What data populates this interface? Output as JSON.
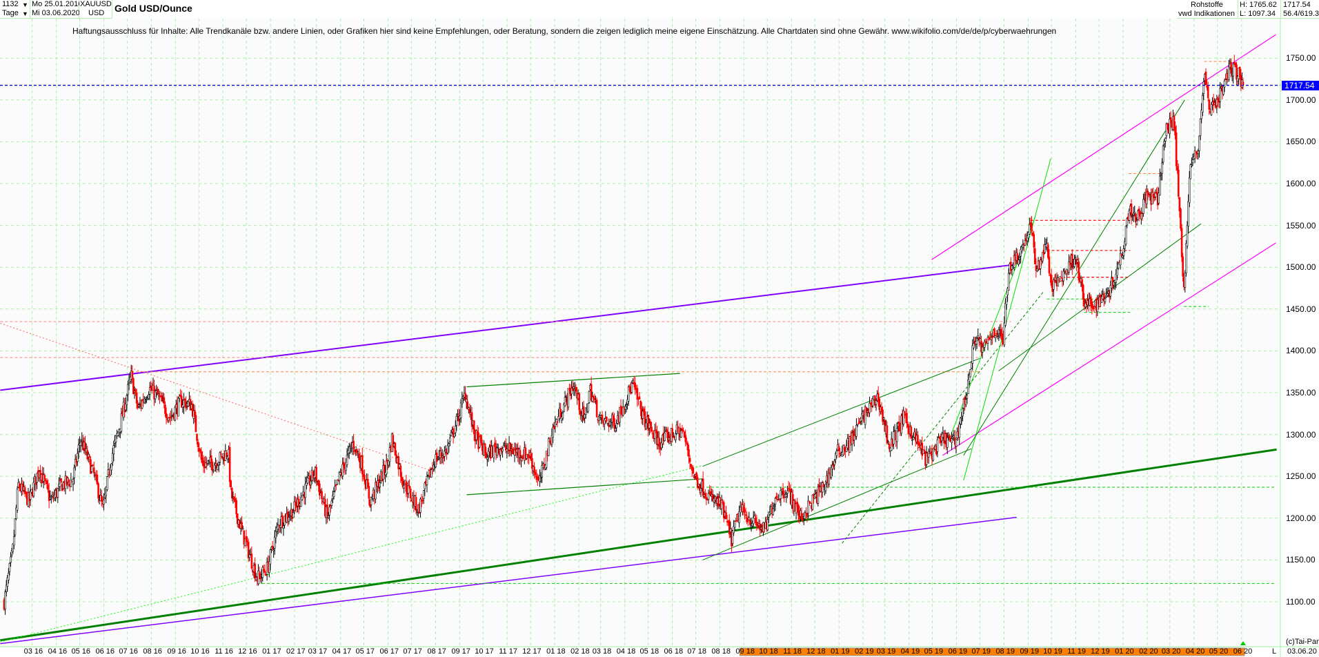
{
  "header": {
    "bars": "1132",
    "period": "Tage",
    "from_date": "Mo 25.01.2016",
    "to_date": "Mi 03.06.2020",
    "symbol": "XAUUSD",
    "currency": "USD",
    "title": "Gold USD/Ounce",
    "category": "Rohstoffe",
    "source": "vwd Indikationen",
    "high": "H: 1765.62",
    "low": "L: 1097.34",
    "last": "1717.54",
    "extra": "56.4/619.3",
    "disclaimer": "Haftungsausschluss für Inhalte: Alle Trendkanäle bzw. andere Linien, oder Grafiken hier sind keine Empfehlungen, oder Beratung, sondern die zeigen lediglich meine eigene Einschätzung. Alle Chartdaten sind ohne Gewähr.  www.wikifolio.com/de/de/p/cyberwaehrungen"
  },
  "footer": {
    "copyright": "(c)Tai-Pan",
    "mode": "L",
    "date": "03.06.20"
  },
  "colors": {
    "up": "#000000",
    "down": "#ff0000",
    "grid": "#a0f0a0",
    "last_price": "#0000ff",
    "range_bar": "#ff8000"
  },
  "chart_data": {
    "type": "candlestick",
    "title": "Gold USD/Ounce",
    "bar_count": 1132,
    "x_range": [
      "2016-01-25",
      "2020-06-03"
    ],
    "ylim": [
      1075,
      1790
    ],
    "y_ticks": [
      "1100.00",
      "1150.00",
      "1200.00",
      "1250.00",
      "1300.00",
      "1350.00",
      "1400.00",
      "1450.00",
      "1500.00",
      "1550.00",
      "1600.00",
      "1650.00",
      "1700.00",
      "1750.00"
    ],
    "last_price": 1717.54,
    "x_ticks": [
      "03 16",
      "04 16",
      "05 16",
      "06 16",
      "07 16",
      "08 16",
      "09 16",
      "10 16",
      "11 16",
      "12 16",
      "01 17",
      "02 17",
      "03 17",
      "04 17",
      "05 17",
      "06 17",
      "07 17",
      "08 17",
      "09 17",
      "10 17",
      "11 17",
      "12 17",
      "01 18",
      "02 18",
      "03 18",
      "04 18",
      "05 18",
      "06 18",
      "07 18",
      "08 18",
      "09 18",
      "10 18",
      "11 18",
      "12 18",
      "01 19",
      "02 19",
      "03 19",
      "04 19",
      "05 19",
      "06 19",
      "07 19",
      "08 19",
      "09 19",
      "10 19",
      "11 19",
      "12 19",
      "01 20",
      "02 20",
      "03 20",
      "04 20",
      "05 20",
      "06 20"
    ],
    "x_tick_dates": [
      "2016-03-01",
      "2016-04-01",
      "2016-05-01",
      "2016-06-01",
      "2016-07-01",
      "2016-08-01",
      "2016-09-01",
      "2016-10-01",
      "2016-11-01",
      "2016-12-01",
      "2017-01-01",
      "2017-02-01",
      "2017-03-01",
      "2017-04-01",
      "2017-05-01",
      "2017-06-01",
      "2017-07-01",
      "2017-08-01",
      "2017-09-01",
      "2017-10-01",
      "2017-11-01",
      "2017-12-01",
      "2018-01-01",
      "2018-02-01",
      "2018-03-01",
      "2018-04-01",
      "2018-05-01",
      "2018-06-01",
      "2018-07-01",
      "2018-08-01",
      "2018-09-01",
      "2018-10-01",
      "2018-11-01",
      "2018-12-01",
      "2019-01-01",
      "2019-02-01",
      "2019-03-01",
      "2019-04-01",
      "2019-05-01",
      "2019-06-01",
      "2019-07-01",
      "2019-08-01",
      "2019-09-01",
      "2019-10-01",
      "2019-11-01",
      "2019-12-01",
      "2020-01-01",
      "2020-02-01",
      "2020-03-01",
      "2020-04-01",
      "2020-05-01",
      "2020-06-01"
    ],
    "highlight_range": [
      "2018-09-01",
      "2020-06-03"
    ],
    "close_path": [
      [
        "2016-01-25",
        1100
      ],
      [
        "2016-02-05",
        1160
      ],
      [
        "2016-02-12",
        1240
      ],
      [
        "2016-02-26",
        1220
      ],
      [
        "2016-03-10",
        1260
      ],
      [
        "2016-03-25",
        1220
      ],
      [
        "2016-04-08",
        1240
      ],
      [
        "2016-04-22",
        1245
      ],
      [
        "2016-05-02",
        1295
      ],
      [
        "2016-05-20",
        1250
      ],
      [
        "2016-05-31",
        1210
      ],
      [
        "2016-06-10",
        1270
      ],
      [
        "2016-06-24",
        1320
      ],
      [
        "2016-07-06",
        1370
      ],
      [
        "2016-07-15",
        1330
      ],
      [
        "2016-07-29",
        1355
      ],
      [
        "2016-08-10",
        1345
      ],
      [
        "2016-08-25",
        1320
      ],
      [
        "2016-09-08",
        1340
      ],
      [
        "2016-09-22",
        1335
      ],
      [
        "2016-10-05",
        1265
      ],
      [
        "2016-10-20",
        1265
      ],
      [
        "2016-11-08",
        1280
      ],
      [
        "2016-11-11",
        1230
      ],
      [
        "2016-11-25",
        1185
      ],
      [
        "2016-12-15",
        1128
      ],
      [
        "2016-12-28",
        1140
      ],
      [
        "2017-01-12",
        1195
      ],
      [
        "2017-01-31",
        1210
      ],
      [
        "2017-02-15",
        1235
      ],
      [
        "2017-02-27",
        1255
      ],
      [
        "2017-03-15",
        1200
      ],
      [
        "2017-03-31",
        1250
      ],
      [
        "2017-04-17",
        1290
      ],
      [
        "2017-04-28",
        1265
      ],
      [
        "2017-05-09",
        1220
      ],
      [
        "2017-05-31",
        1265
      ],
      [
        "2017-06-06",
        1295
      ],
      [
        "2017-06-20",
        1245
      ],
      [
        "2017-07-10",
        1210
      ],
      [
        "2017-07-31",
        1270
      ],
      [
        "2017-08-15",
        1280
      ],
      [
        "2017-08-30",
        1320
      ],
      [
        "2017-09-08",
        1350
      ],
      [
        "2017-09-20",
        1300
      ],
      [
        "2017-10-05",
        1275
      ],
      [
        "2017-10-20",
        1285
      ],
      [
        "2017-11-10",
        1280
      ],
      [
        "2017-11-30",
        1275
      ],
      [
        "2017-12-12",
        1240
      ],
      [
        "2017-12-29",
        1305
      ],
      [
        "2018-01-25",
        1360
      ],
      [
        "2018-02-08",
        1315
      ],
      [
        "2018-02-15",
        1355
      ],
      [
        "2018-03-01",
        1315
      ],
      [
        "2018-03-20",
        1315
      ],
      [
        "2018-04-11",
        1360
      ],
      [
        "2018-04-25",
        1320
      ],
      [
        "2018-05-15",
        1290
      ],
      [
        "2018-05-31",
        1300
      ],
      [
        "2018-06-14",
        1305
      ],
      [
        "2018-06-29",
        1250
      ],
      [
        "2018-07-19",
        1225
      ],
      [
        "2018-08-03",
        1215
      ],
      [
        "2018-08-16",
        1175
      ],
      [
        "2018-08-27",
        1210
      ],
      [
        "2018-09-14",
        1195
      ],
      [
        "2018-09-28",
        1185
      ],
      [
        "2018-10-11",
        1225
      ],
      [
        "2018-10-26",
        1235
      ],
      [
        "2018-11-13",
        1200
      ],
      [
        "2018-11-28",
        1220
      ],
      [
        "2018-12-14",
        1240
      ],
      [
        "2018-12-31",
        1280
      ],
      [
        "2019-01-15",
        1290
      ],
      [
        "2019-01-31",
        1320
      ],
      [
        "2019-02-20",
        1345
      ],
      [
        "2019-03-07",
        1285
      ],
      [
        "2019-03-25",
        1320
      ],
      [
        "2019-04-12",
        1290
      ],
      [
        "2019-04-23",
        1270
      ],
      [
        "2019-05-15",
        1295
      ],
      [
        "2019-05-30",
        1290
      ],
      [
        "2019-06-14",
        1350
      ],
      [
        "2019-06-25",
        1420
      ],
      [
        "2019-07-05",
        1400
      ],
      [
        "2019-07-19",
        1425
      ],
      [
        "2019-07-31",
        1415
      ],
      [
        "2019-08-07",
        1500
      ],
      [
        "2019-08-23",
        1520
      ],
      [
        "2019-09-04",
        1550
      ],
      [
        "2019-09-12",
        1495
      ],
      [
        "2019-09-24",
        1530
      ],
      [
        "2019-10-01",
        1475
      ],
      [
        "2019-10-15",
        1490
      ],
      [
        "2019-11-01",
        1515
      ],
      [
        "2019-11-12",
        1455
      ],
      [
        "2019-11-26",
        1455
      ],
      [
        "2019-12-16",
        1475
      ],
      [
        "2019-12-31",
        1520
      ],
      [
        "2020-01-08",
        1570
      ],
      [
        "2020-01-20",
        1560
      ],
      [
        "2020-01-31",
        1585
      ],
      [
        "2020-02-14",
        1580
      ],
      [
        "2020-02-24",
        1660
      ],
      [
        "2020-03-06",
        1680
      ],
      [
        "2020-03-19",
        1475
      ],
      [
        "2020-03-27",
        1620
      ],
      [
        "2020-04-06",
        1640
      ],
      [
        "2020-04-14",
        1730
      ],
      [
        "2020-04-21",
        1690
      ],
      [
        "2020-05-04",
        1705
      ],
      [
        "2020-05-18",
        1740
      ],
      [
        "2020-05-29",
        1730
      ],
      [
        "2020-06-03",
        1717.54
      ]
    ],
    "trend_lines": [
      {
        "from": [
          "2016-01-20",
          1353
        ],
        "to": [
          "2019-08-13",
          1503
        ],
        "color": "#8000ff",
        "style": "solid",
        "weight": 2
      },
      {
        "from": [
          "2016-01-20",
          1050
        ],
        "to": [
          "2019-08-17",
          1201
        ],
        "color": "#8000ff",
        "style": "solid",
        "weight": 1.5
      },
      {
        "from": [
          "2016-01-20",
          1054
        ],
        "to": [
          "2020-07-16",
          1282
        ],
        "color": "#008000",
        "style": "solid",
        "weight": 3
      },
      {
        "from": [
          "2016-01-20",
          1052
        ],
        "to": [
          "2018-07-10",
          1263
        ],
        "color": "#00ff00",
        "style": "dotted",
        "weight": 1
      },
      {
        "from": [
          "2016-01-20",
          1433
        ],
        "to": [
          "2017-08-01",
          1255
        ],
        "color": "#ff6060",
        "style": "dotted",
        "weight": 1
      },
      {
        "from": [
          "2019-04-30",
          1509
        ],
        "to": [
          "2020-07-15",
          1778
        ],
        "color": "#ff00ff",
        "style": "solid",
        "weight": 1.2
      },
      {
        "from": [
          "2019-05-14",
          1275
        ],
        "to": [
          "2020-07-15",
          1529
        ],
        "color": "#ff00ff",
        "style": "solid",
        "weight": 1.2
      },
      {
        "from": [
          "2017-09-10",
          1357
        ],
        "to": [
          "2018-06-11",
          1373
        ],
        "color": "#008000",
        "style": "solid",
        "weight": 1.2
      },
      {
        "from": [
          "2017-09-10",
          1228
        ],
        "to": [
          "2018-07-10",
          1247
        ],
        "color": "#008000",
        "style": "solid",
        "weight": 1.2
      },
      {
        "from": [
          "2018-07-10",
          1262
        ],
        "to": [
          "2019-07-01",
          1391
        ],
        "color": "#008000",
        "style": "solid",
        "weight": 1
      },
      {
        "from": [
          "2018-07-10",
          1150
        ],
        "to": [
          "2019-06-20",
          1283
        ],
        "color": "#008000",
        "style": "solid",
        "weight": 1
      },
      {
        "from": [
          "2019-06-10",
          1245
        ],
        "to": [
          "2019-09-30",
          1630
        ],
        "color": "#00e000",
        "style": "solid",
        "weight": 1
      },
      {
        "from": [
          "2019-05-25",
          1300
        ],
        "to": [
          "2019-09-10",
          1560
        ],
        "color": "#00e000",
        "style": "solid",
        "weight": 1
      },
      {
        "from": [
          "2019-07-25",
          1376
        ],
        "to": [
          "2020-04-10",
          1552
        ],
        "color": "#008000",
        "style": "solid",
        "weight": 1
      },
      {
        "from": [
          "2019-06-10",
          1275
        ],
        "to": [
          "2020-03-20",
          1700
        ],
        "color": "#008000",
        "style": "solid",
        "weight": 1
      },
      {
        "from": [
          "2019-01-05",
          1170
        ],
        "to": [
          "2019-09-20",
          1470
        ],
        "color": "#008000",
        "style": "dashed",
        "weight": 1
      },
      {
        "from": [
          "2016-07-06",
          1375
        ],
        "to": [
          "2019-06-30",
          1375
        ],
        "color": "#ff8040",
        "style": "dashed",
        "weight": 1
      },
      {
        "from": [
          "2016-01-20",
          1392
        ],
        "to": [
          "2019-06-30",
          1392
        ],
        "color": "#ff8080",
        "style": "dashed",
        "weight": 1
      },
      {
        "from": [
          "2016-01-20",
          1435
        ],
        "to": [
          "2019-08-10",
          1435
        ],
        "color": "#ff8080",
        "style": "dashed",
        "weight": 1
      },
      {
        "from": [
          "2019-09-04",
          1556
        ],
        "to": [
          "2020-01-10",
          1556
        ],
        "color": "#ff0000",
        "style": "dashed",
        "weight": 1.2
      },
      {
        "from": [
          "2019-09-25",
          1520
        ],
        "to": [
          "2020-01-10",
          1520
        ],
        "color": "#ff0000",
        "style": "dashed",
        "weight": 1.2
      },
      {
        "from": [
          "2019-10-15",
          1488
        ],
        "to": [
          "2020-01-10",
          1488
        ],
        "color": "#ff0000",
        "style": "dashed",
        "weight": 1.2
      },
      {
        "from": [
          "2018-06-20",
          1237
        ],
        "to": [
          "2020-07-15",
          1237
        ],
        "color": "#00cc00",
        "style": "dashed",
        "weight": 1
      },
      {
        "from": [
          "2016-12-15",
          1122
        ],
        "to": [
          "2020-07-15",
          1122
        ],
        "color": "#00cc00",
        "style": "dashed",
        "weight": 1
      },
      {
        "from": [
          "2019-09-25",
          1462
        ],
        "to": [
          "2019-12-10",
          1462
        ],
        "color": "#00cc00",
        "style": "dashed",
        "weight": 1
      },
      {
        "from": [
          "2019-11-12",
          1446
        ],
        "to": [
          "2020-01-10",
          1446
        ],
        "color": "#00cc00",
        "style": "dashed",
        "weight": 1
      },
      {
        "from": [
          "2020-03-19",
          1453
        ],
        "to": [
          "2020-04-20",
          1453
        ],
        "color": "#00cc00",
        "style": "dashed",
        "weight": 1
      },
      {
        "from": [
          "2020-04-14",
          1746
        ],
        "to": [
          "2020-05-20",
          1746
        ],
        "color": "#ff8040",
        "style": "dashed",
        "weight": 1
      },
      {
        "from": [
          "2020-01-08",
          1612
        ],
        "to": [
          "2020-02-20",
          1612
        ],
        "color": "#ff8040",
        "style": "dashed",
        "weight": 1
      }
    ]
  }
}
